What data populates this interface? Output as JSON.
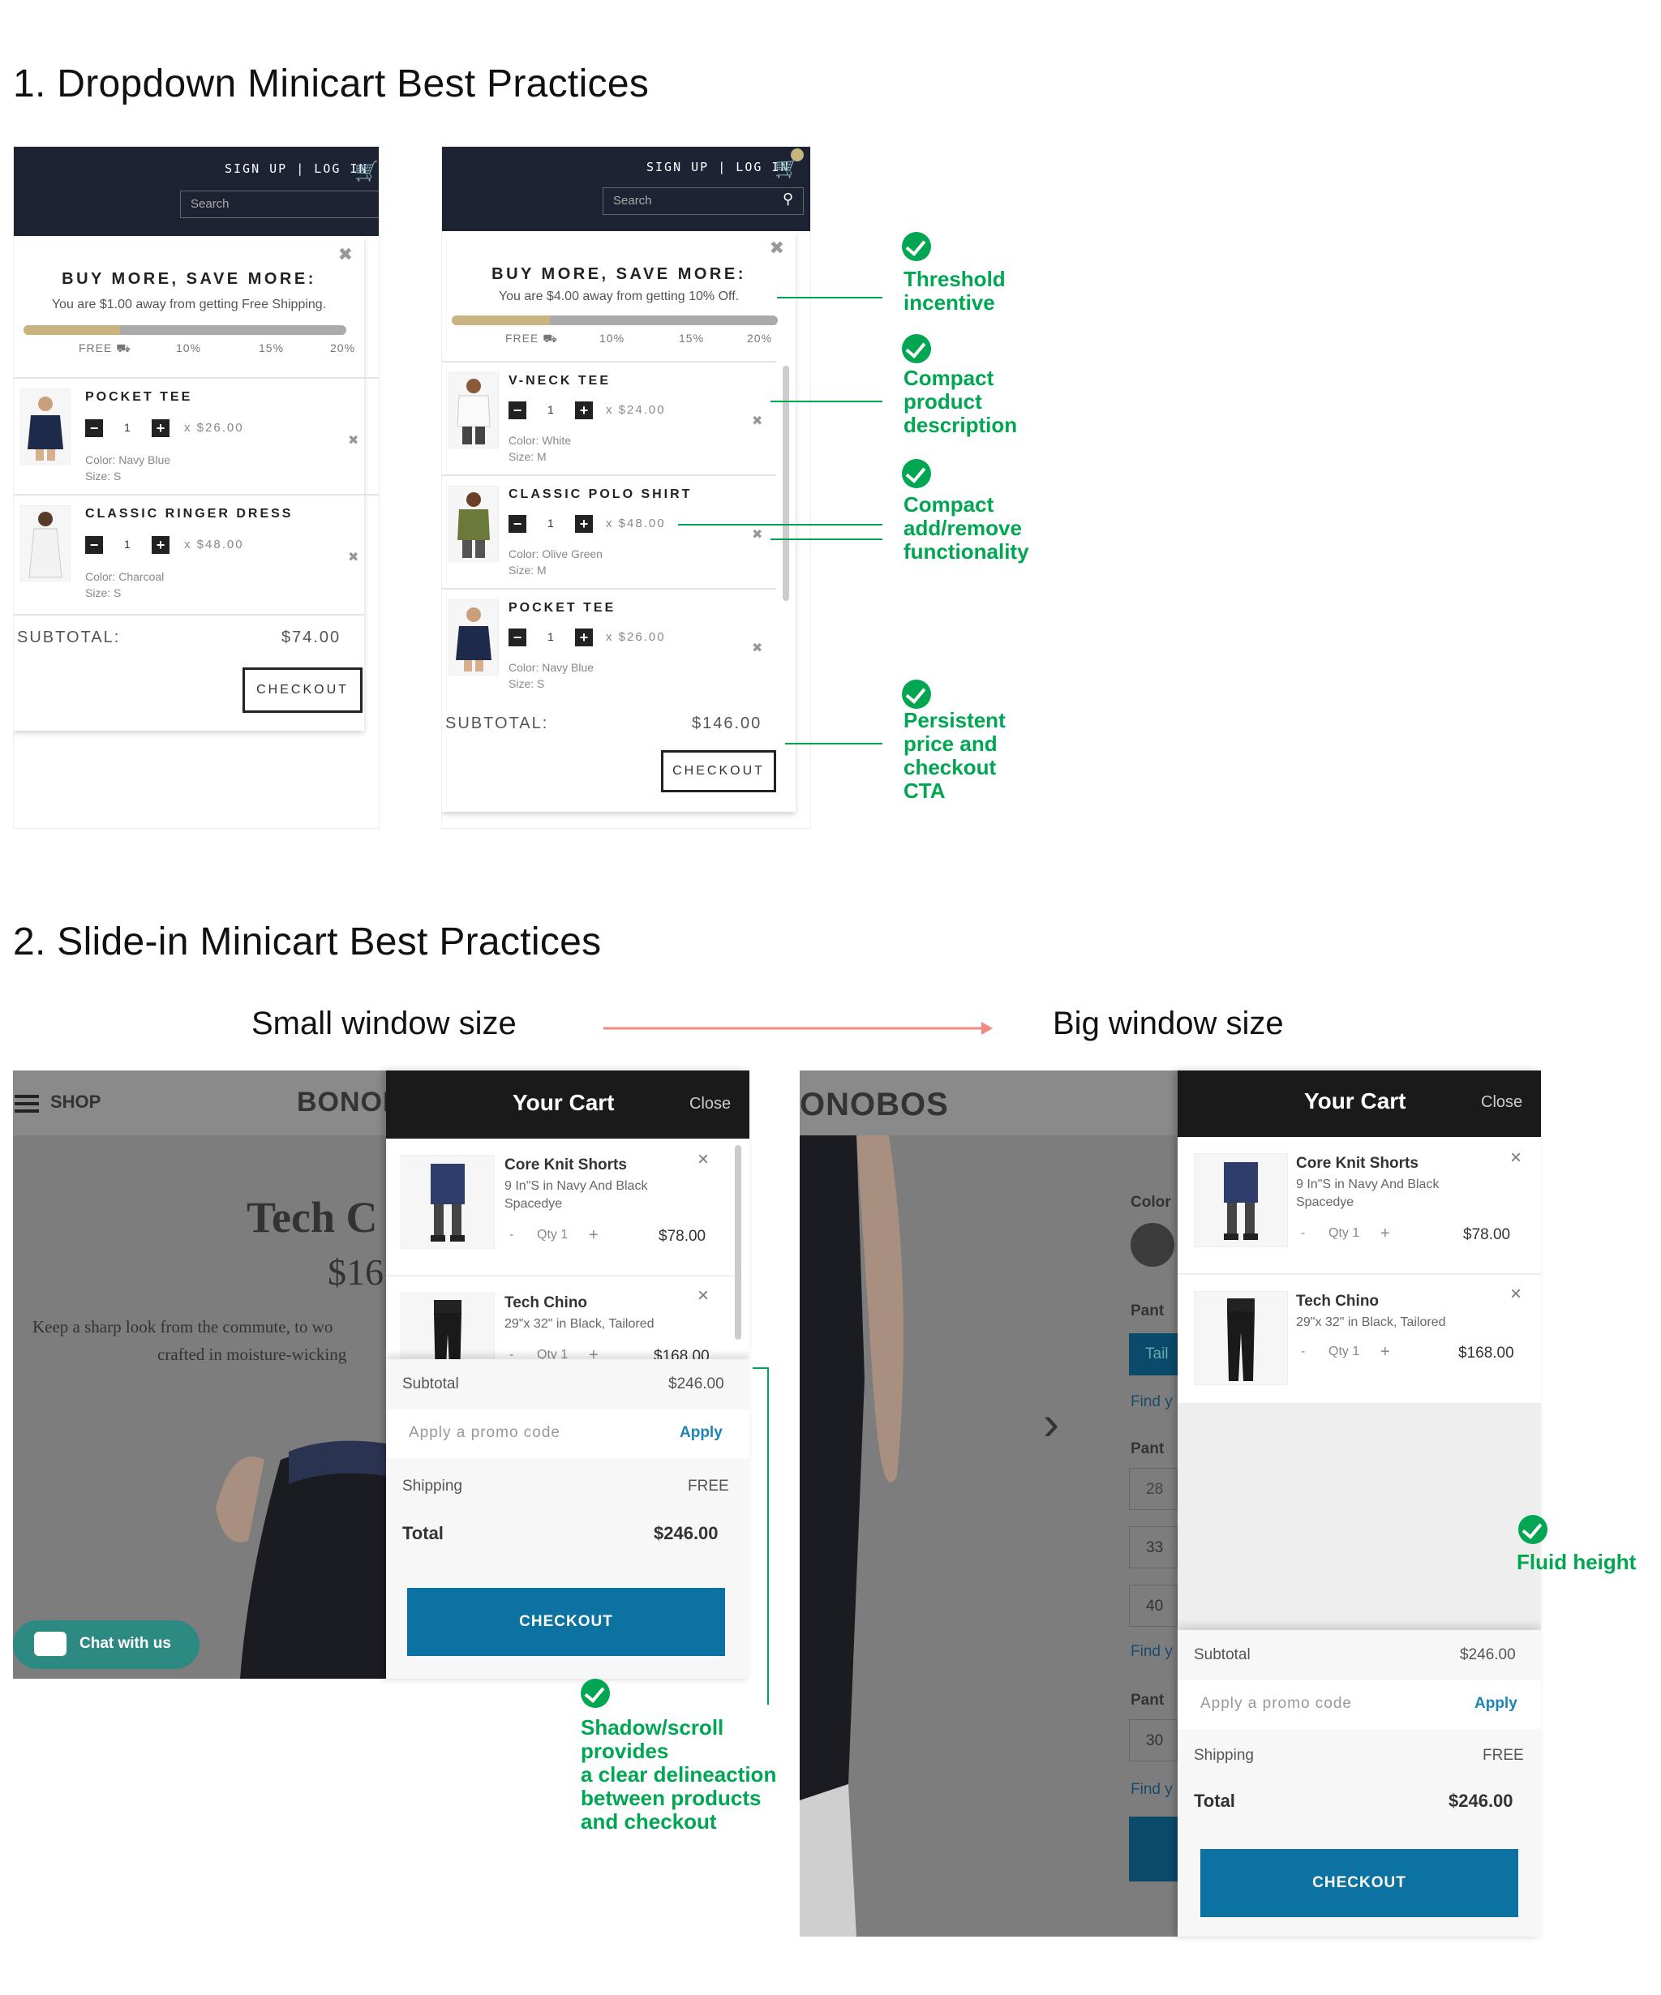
{
  "section1": {
    "title": "1. Dropdown Minicart Best Practices"
  },
  "section2": {
    "title": "2. Slide-in Minicart Best Practices",
    "small_label": "Small window size",
    "big_label": "Big window size"
  },
  "dropdown_header": {
    "links": "SIGN UP | LOG IN",
    "search_placeholder": "Search"
  },
  "dropdown1": {
    "promo_title": "BUY MORE, SAVE MORE:",
    "promo_sub": "You are $1.00 away from getting Free Shipping.",
    "progress": 0.3,
    "ticks": [
      "FREE",
      "10%",
      "15%",
      "20%"
    ],
    "items": [
      {
        "name": "POCKET TEE",
        "qty": "1",
        "price": "x $26.00",
        "color": "Color: Navy Blue",
        "size": "Size: S"
      },
      {
        "name": "CLASSIC RINGER DRESS",
        "qty": "1",
        "price": "x $48.00",
        "color": "Color: Charcoal",
        "size": "Size: S"
      }
    ],
    "subtotal_label": "SUBTOTAL:",
    "subtotal": "$74.00",
    "checkout": "CHECKOUT"
  },
  "dropdown2": {
    "promo_title": "BUY MORE, SAVE MORE:",
    "promo_sub": "You are $4.00 away from getting 10% Off.",
    "progress": 0.3,
    "ticks": [
      "FREE",
      "10%",
      "15%",
      "20%"
    ],
    "items": [
      {
        "name": "V-NECK TEE",
        "qty": "1",
        "price": "x $24.00",
        "color": "Color: White",
        "size": "Size: M"
      },
      {
        "name": "CLASSIC POLO SHIRT",
        "qty": "1",
        "price": "x $48.00",
        "color": "Color: Olive Green",
        "size": "Size: M"
      },
      {
        "name": "POCKET TEE",
        "qty": "1",
        "price": "x $26.00",
        "color": "Color: Navy Blue",
        "size": "Size: S"
      }
    ],
    "subtotal_label": "SUBTOTAL:",
    "subtotal": "$146.00",
    "checkout": "CHECKOUT"
  },
  "annotations": {
    "threshold": [
      "Threshold",
      "incentive"
    ],
    "compact_desc": [
      "Compact",
      "product",
      "description"
    ],
    "compact_addremove": [
      "Compact",
      "add/remove",
      "functionality"
    ],
    "persistent": [
      "Persistent",
      "price and",
      "checkout",
      "CTA"
    ],
    "shadow": [
      "Shadow/scroll",
      "provides",
      "a clear delineaction",
      "between products",
      "and checkout"
    ],
    "fluid": [
      "Fluid height"
    ]
  },
  "site_small": {
    "shop": "SHOP",
    "logo": "BONOI",
    "headline": "Tech C",
    "price": "$16",
    "body1": "Keep a sharp look from the commute, to wo",
    "body2": "crafted in moisture-wicking",
    "chat": "Chat with us"
  },
  "site_big": {
    "logo": "ONOBOS",
    "labels": [
      "Color",
      "Pant",
      "Tail",
      "Find y",
      "Pant",
      "28",
      "33",
      "40",
      "Find y",
      "Pant",
      "30",
      "Find y"
    ]
  },
  "slide_cart": {
    "title": "Your Cart",
    "close": "Close",
    "items": [
      {
        "name": "Core Knit Shorts",
        "desc1": "9 In\"S in Navy And Black",
        "desc2": "Spacedye",
        "minus": "-",
        "qty": "Qty 1",
        "plus": "+",
        "price": "$78.00",
        "remove": "×"
      },
      {
        "name": "Tech Chino",
        "desc1": "29\"x 32\" in Black, Tailored",
        "desc2": "",
        "minus": "-",
        "qty": "Qty 1",
        "plus": "+",
        "price": "$168.00",
        "remove": "×"
      }
    ],
    "subtotal_label": "Subtotal",
    "subtotal": "$246.00",
    "promo_placeholder": "Apply a promo code",
    "apply": "Apply",
    "shipping_label": "Shipping",
    "shipping": "FREE",
    "total_label": "Total",
    "total": "$246.00",
    "checkout": "CHECKOUT"
  },
  "colors": {
    "annotation": "#00a651",
    "checkout_blue": "#0b72a1",
    "header_dark": "#1d2333",
    "progress_fill": "#c9b37e",
    "arrow": "#f08a80"
  }
}
